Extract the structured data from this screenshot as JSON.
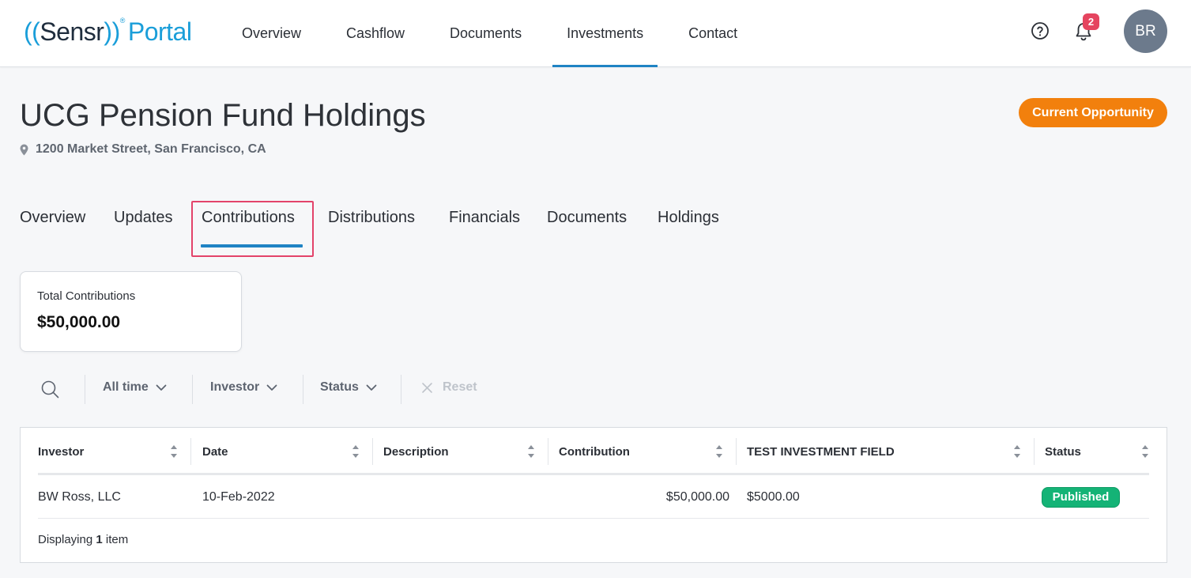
{
  "app": {
    "logo_paren_open": "((",
    "logo_brand": "Sensr",
    "logo_paren_close": "))",
    "logo_product": "Portal",
    "logo_reg": "®"
  },
  "nav": {
    "items": [
      {
        "label": "Overview"
      },
      {
        "label": "Cashflow"
      },
      {
        "label": "Documents"
      },
      {
        "label": "Investments",
        "active": true
      },
      {
        "label": "Contact"
      }
    ],
    "notification_count": "2",
    "avatar_initials": "BR"
  },
  "header": {
    "title": "UCG Pension Fund Holdings",
    "address": "1200 Market Street, San Francisco, CA",
    "badge": "Current Opportunity"
  },
  "tabs": [
    {
      "label": "Overview"
    },
    {
      "label": "Updates"
    },
    {
      "label": "Contributions",
      "active": true
    },
    {
      "label": "Distributions"
    },
    {
      "label": "Financials"
    },
    {
      "label": "Documents"
    },
    {
      "label": "Holdings"
    }
  ],
  "summary": {
    "label": "Total Contributions",
    "value": "$50,000.00"
  },
  "filters": {
    "time": "All time",
    "investor": "Investor",
    "status": "Status",
    "reset": "Reset"
  },
  "table": {
    "columns": [
      "Investor",
      "Date",
      "Description",
      "Contribution",
      "TEST INVESTMENT FIELD",
      "Status"
    ],
    "rows": [
      {
        "investor": "BW Ross, LLC",
        "date": "10-Feb-2022",
        "description": "",
        "contribution": "$50,000.00",
        "test_field": "$5000.00",
        "status": "Published"
      }
    ],
    "footer_prefix": "Displaying",
    "footer_count": "1",
    "footer_suffix": "item"
  },
  "colors": {
    "accent": "#1f83c4",
    "logo_blue": "#1a9ed9",
    "opportunity_orange": "#f2800d",
    "published_green": "#14b376",
    "notification_red": "#e5445f",
    "highlight_pink": "#e3436a"
  },
  "icons": [
    "help-icon",
    "bell-icon",
    "location-pin-icon",
    "search-icon",
    "chevron-down-icon",
    "close-icon",
    "sort-icon"
  ]
}
